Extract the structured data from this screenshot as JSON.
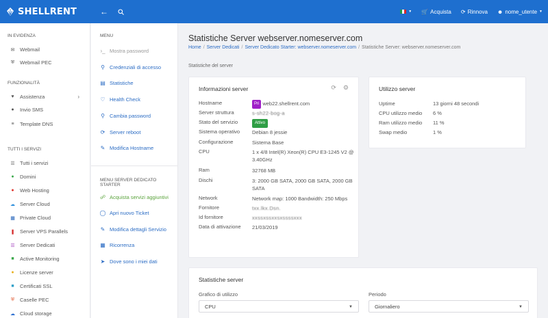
{
  "app": {
    "logo_text": "SHELLRENT",
    "brand_color": "#1e6fcf"
  },
  "topbar": {
    "back_icon": "arrow-left-icon",
    "search_icon": "search-icon",
    "cart_label": "Acquista",
    "renew_label": "Rinnova",
    "user_label": "nome_utente"
  },
  "sidebar": {
    "section_evidenza": "IN EVIDENZA",
    "evidenza": [
      {
        "label": "Webmail",
        "icon": "envelope-icon"
      },
      {
        "label": "Webmail PEC",
        "icon": "shield-icon"
      }
    ],
    "section_funzionalita": "FUNZIONALITÀ",
    "funzionalita": [
      {
        "label": "Assistenza",
        "icon": "heart-icon"
      },
      {
        "label": "Invio SMS",
        "icon": "chat-icon"
      },
      {
        "label": "Template DNS",
        "icon": "signal-icon"
      }
    ],
    "section_servizi": "TUTTI I SERVIZI",
    "servizi": [
      {
        "label": "Tutti i servizi",
        "icon": "bars-icon"
      },
      {
        "label": "Domini",
        "icon": "globe-icon"
      },
      {
        "label": "Web Hosting",
        "icon": "hosting-icon"
      },
      {
        "label": "Server Cloud",
        "icon": "cloud-icon"
      },
      {
        "label": "Private Cloud",
        "icon": "grid-icon"
      },
      {
        "label": "Server VPS Parallels",
        "icon": "parallels-icon"
      },
      {
        "label": "Server Dedicati",
        "icon": "server-icon"
      },
      {
        "label": "Active Monitoring",
        "icon": "monitor-icon"
      },
      {
        "label": "Licenze server",
        "icon": "license-icon"
      },
      {
        "label": "Certificati SSL",
        "icon": "certificate-icon"
      },
      {
        "label": "Caselle PEC",
        "icon": "pec-icon"
      },
      {
        "label": "Cloud storage",
        "icon": "storage-icon"
      }
    ]
  },
  "menu": {
    "title": "MENU",
    "items": [
      {
        "label": "Mostra password",
        "icon": "terminal-icon",
        "state": "disabled"
      },
      {
        "label": "Credenziali di accesso",
        "icon": "key-icon",
        "state": "normal"
      },
      {
        "label": "Statistiche",
        "icon": "chart-icon",
        "state": "normal"
      },
      {
        "label": "Health Check",
        "icon": "heartbeat-icon",
        "state": "normal"
      },
      {
        "label": "Cambia password",
        "icon": "lock-icon",
        "state": "normal"
      },
      {
        "label": "Server reboot",
        "icon": "reboot-icon",
        "state": "normal"
      },
      {
        "label": "Modifica Hostname",
        "icon": "edit-icon",
        "state": "normal"
      }
    ],
    "title2": "MENU SERVER DEDICATO STARTER",
    "items2": [
      {
        "label": "Acquista servizi aggiuntivi",
        "icon": "cart-icon",
        "state": "green"
      },
      {
        "label": "Apri nuovo Ticket",
        "icon": "ticket-icon",
        "state": "normal"
      },
      {
        "label": "Modifica dettagli Servizio",
        "icon": "edit-icon",
        "state": "normal"
      },
      {
        "label": "Ricorrenza",
        "icon": "calendar-icon",
        "state": "normal"
      },
      {
        "label": "Dove sono i miei dati",
        "icon": "location-icon",
        "state": "normal"
      }
    ]
  },
  "main": {
    "title": "Statistiche Server webserver.nomeserver.com",
    "breadcrumb": [
      "Home",
      "Server Dedicati",
      "Server Dedicato Starter: webserver.nomeserver.com",
      "Statistiche Server: webserver.nomeserver.com"
    ],
    "subtitle": "Statistiche del server"
  },
  "info": {
    "title": "Informazioni server",
    "pri_badge": "Pri",
    "rows": [
      {
        "label": "Hostname",
        "value": "web22.shellrent.com"
      },
      {
        "label": "Server struttura",
        "value": "s-sh22-bog-a"
      },
      {
        "label": "Stato del servizio",
        "value": "Attivo"
      },
      {
        "label": "Sistema operativo",
        "value": "Debian 8 jessie"
      },
      {
        "label": "Configurazione",
        "value": "Sistema Base"
      },
      {
        "label": "CPU",
        "value": "1 x 4/8 Intel(R) Xeon(R) CPU E3-1245 V2 @ 3.40GHz"
      },
      {
        "label": "Ram",
        "value": "32768 MB"
      },
      {
        "label": "Dischi",
        "value": "3: 2000 GB SATA, 2000 GB SATA, 2000 GB SATA"
      },
      {
        "label": "Network",
        "value": "Network map: 1000 Bandwidth: 250 Mbps"
      },
      {
        "label": "Fornitore",
        "value": "txx.lkx.Dsn."
      },
      {
        "label": "Id fornitore",
        "value": "xxssxssxxsxssssxxx"
      },
      {
        "label": "Data di attivazione",
        "value": "21/03/2019"
      }
    ]
  },
  "usage": {
    "title": "Utilizzo server",
    "rows": [
      {
        "label": "Uptime",
        "value": "13 giorni 48 secondi"
      },
      {
        "label": "CPU utilizzo medio",
        "value": "6 %"
      },
      {
        "label": "Ram utilizzo medio",
        "value": "11 %"
      },
      {
        "label": "Swap medio",
        "value": "1 %"
      }
    ]
  },
  "stats": {
    "title": "Statistiche server",
    "graph_label": "Grafico di utilizzo",
    "graph_value": "CPU",
    "period_label": "Periodo",
    "period_value": "Giornaliero"
  }
}
